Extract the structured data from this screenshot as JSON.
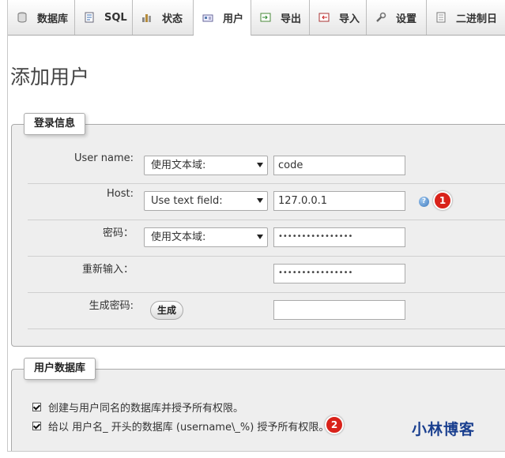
{
  "tabs": [
    {
      "label": "数据库",
      "icon": "database-icon",
      "active": false
    },
    {
      "label": "SQL",
      "icon": "sql-icon",
      "active": false
    },
    {
      "label": "状态",
      "icon": "status-icon",
      "active": false
    },
    {
      "label": "用户",
      "icon": "users-icon",
      "active": true
    },
    {
      "label": "导出",
      "icon": "export-icon",
      "active": false
    },
    {
      "label": "导入",
      "icon": "import-icon",
      "active": false
    },
    {
      "label": "设置",
      "icon": "wrench-icon",
      "active": false
    },
    {
      "label": "二进制日",
      "icon": "binlog-icon",
      "active": false
    }
  ],
  "page_title": "添加用户",
  "login_info": {
    "legend": "登录信息",
    "username": {
      "label": "User name:",
      "select": "使用文本域:",
      "value": "code"
    },
    "host": {
      "label": "Host:",
      "select": "Use text field:",
      "value": "127.0.0.1",
      "help": "?",
      "marker": "1"
    },
    "password": {
      "label": "密码：",
      "select": "使用文本域:",
      "value": "••••••••••••••••"
    },
    "retype": {
      "label": "重新输入：",
      "value": "••••••••••••••••"
    },
    "generate": {
      "label": "生成密码:",
      "button": "生成",
      "value": ""
    }
  },
  "user_db": {
    "legend": "用户数据库",
    "options": [
      {
        "label": "创建与用户同名的数据库并授予所有权限。",
        "checked": true
      },
      {
        "label": "给以 用户名_ 开头的数据库 (username\\_%) 授予所有权限。",
        "checked": true,
        "marker": "2"
      }
    ]
  },
  "watermark": "小林博客",
  "colors": {
    "tab_text": "#235a81",
    "marker": "#d9221a",
    "fieldset_bg": "#eeeeee"
  }
}
